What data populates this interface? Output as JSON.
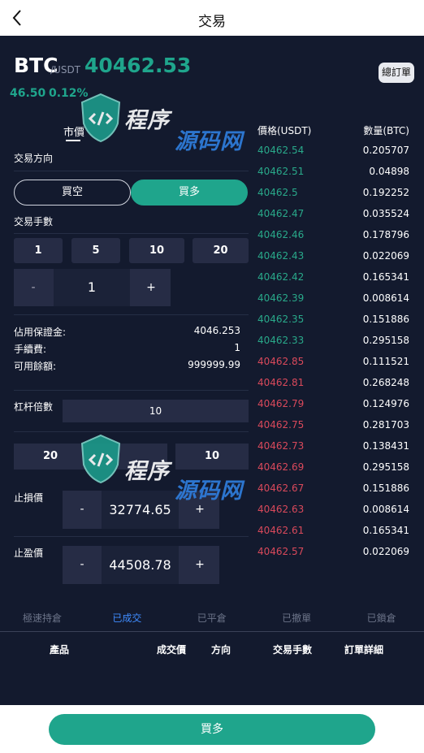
{
  "header": {
    "title": "交易"
  },
  "ticker": {
    "symbol": "BTC",
    "quote": "/USDT",
    "price": "40462.53",
    "change": "46.50",
    "change_pct": "0.12%",
    "orders_button": "總訂單"
  },
  "form": {
    "market_tab": "市價",
    "direction_label": "交易方向",
    "short_label": "買空",
    "long_label": "買多",
    "lots_label": "交易手數",
    "quick_lots": [
      "1",
      "5",
      "10",
      "20"
    ],
    "lots_minus": "-",
    "lots_value": "1",
    "lots_plus": "+",
    "margin_label": "佔用保證金:",
    "margin_value": "4046.253",
    "fee_label": "手續費:",
    "fee_value": "1",
    "balance_label": "可用餘額:",
    "balance_value": "999999.99",
    "leverage_label": "杠杆倍數",
    "leverage_value": "10",
    "lev_left": "20",
    "lev_right": "10",
    "stop_loss_label": "止損價",
    "stop_loss_minus": "-",
    "stop_loss_value": "32774.65",
    "stop_loss_plus": "+",
    "take_profit_label": "止盈價",
    "take_profit_minus": "-",
    "take_profit_value": "44508.78",
    "take_profit_plus": "+"
  },
  "orderbook": {
    "price_header": "價格(USDT)",
    "qty_header": "數量(BTC)",
    "rows": [
      {
        "price": "40462.54",
        "qty": "0.205707",
        "side": "buy"
      },
      {
        "price": "40462.51",
        "qty": "0.04898",
        "side": "buy"
      },
      {
        "price": "40462.5",
        "qty": "0.192252",
        "side": "buy"
      },
      {
        "price": "40462.47",
        "qty": "0.035524",
        "side": "buy"
      },
      {
        "price": "40462.46",
        "qty": "0.178796",
        "side": "buy"
      },
      {
        "price": "40462.43",
        "qty": "0.022069",
        "side": "buy"
      },
      {
        "price": "40462.42",
        "qty": "0.165341",
        "side": "buy"
      },
      {
        "price": "40462.39",
        "qty": "0.008614",
        "side": "buy"
      },
      {
        "price": "40462.35",
        "qty": "0.151886",
        "side": "buy"
      },
      {
        "price": "40462.33",
        "qty": "0.295158",
        "side": "buy"
      },
      {
        "price": "40462.85",
        "qty": "0.111521",
        "side": "sell"
      },
      {
        "price": "40462.81",
        "qty": "0.268248",
        "side": "sell"
      },
      {
        "price": "40462.79",
        "qty": "0.124976",
        "side": "sell"
      },
      {
        "price": "40462.75",
        "qty": "0.281703",
        "side": "sell"
      },
      {
        "price": "40462.73",
        "qty": "0.138431",
        "side": "sell"
      },
      {
        "price": "40462.69",
        "qty": "0.295158",
        "side": "sell"
      },
      {
        "price": "40462.67",
        "qty": "0.151886",
        "side": "sell"
      },
      {
        "price": "40462.63",
        "qty": "0.008614",
        "side": "sell"
      },
      {
        "price": "40462.61",
        "qty": "0.165341",
        "side": "sell"
      },
      {
        "price": "40462.57",
        "qty": "0.022069",
        "side": "sell"
      }
    ]
  },
  "positions": {
    "tabs": [
      "極速持倉",
      "已成交",
      "已平倉",
      "已撤單",
      "已鎖倉"
    ],
    "active_tab": "已成交",
    "columns": [
      "產品",
      "成交價",
      "方向",
      "交易手數",
      "訂單詳細"
    ]
  },
  "bottom": {
    "buy_label": "買多"
  },
  "watermark": {
    "text_a": "程序",
    "text_b": "源码网"
  },
  "colors": {
    "background": "#131a2e",
    "accent": "#1fa58c",
    "buy": "#29a98a",
    "sell": "#d9495b",
    "panel": "#262c45",
    "tab_active": "#3f8cff"
  }
}
